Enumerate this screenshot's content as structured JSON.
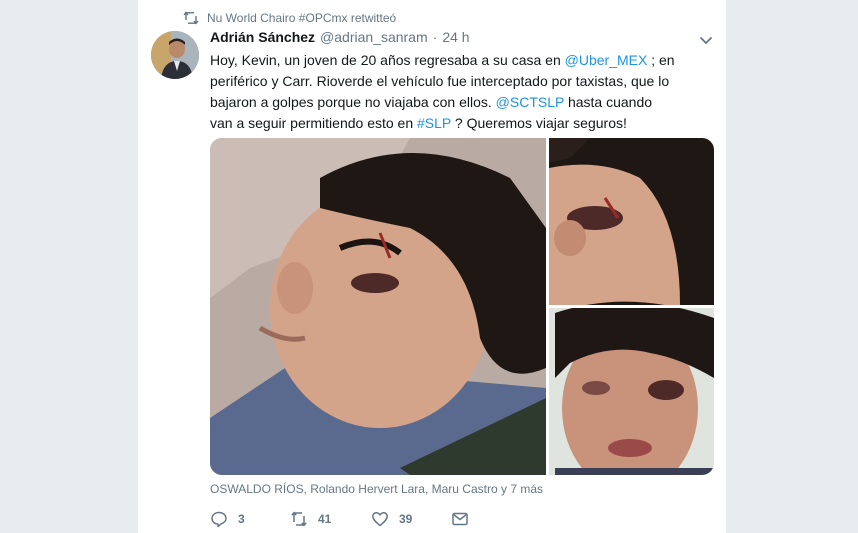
{
  "context": {
    "icon": "retweet-icon",
    "text": "Nu World Chairo #OPCmx retwitteó"
  },
  "tweet": {
    "author_name": "Adrián Sánchez",
    "handle": "@adrian_sanram",
    "separator": "·",
    "time": "24 h",
    "menu_icon": "chevron-down-icon",
    "text_parts": {
      "p1": "Hoy, Kevin, un joven de 20 años regresaba a su casa en ",
      "mention_uber": "@Uber_MEX",
      "p2": " ; en periférico y Carr. Rioverde el vehículo fue interceptado por taxistas, que lo bajaron a golpes porque no viajaba con ellos. ",
      "mention_sct": "@SCTSLP",
      "p3": " hasta cuando van a seguir permitiendo esto en ",
      "hashtag": "#SLP",
      "p4": " ? Queremos viajar seguros!"
    },
    "tagged_users": "OSWALDO RÍOS, Rolando Hervert Lara, Maru Castro y 7 más",
    "actions": {
      "reply_count": "3",
      "retweet_count": "41",
      "like_count": "39"
    }
  },
  "colors": {
    "link": "#1b95e0",
    "secondary_text": "#657786",
    "page_background": "#e6ecf0"
  }
}
